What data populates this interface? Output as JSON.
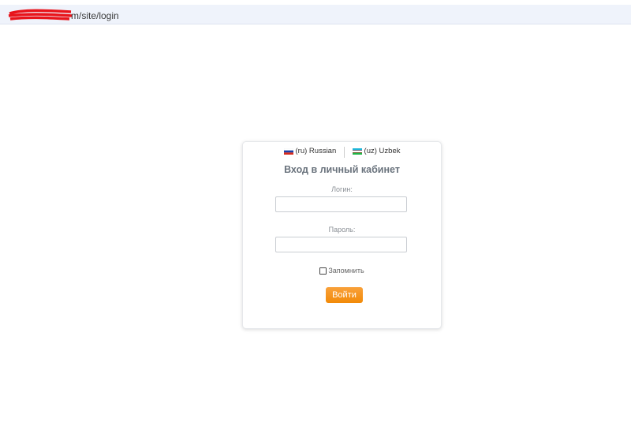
{
  "browser": {
    "url_visible": "m/site/login"
  },
  "languages": [
    {
      "code": "ru",
      "label": "(ru) Russian"
    },
    {
      "code": "uz",
      "label": "(uz) Uzbek"
    }
  ],
  "login_card": {
    "title": "Вход в личный кабинет",
    "login_label": "Логин:",
    "login_value": "",
    "password_label": "Пароль:",
    "password_value": "",
    "remember_label": "Запомнить",
    "remember_checked": false,
    "submit_label": "Войти"
  },
  "colors": {
    "button": "#f28a08",
    "title": "#6a737d",
    "address_bar": "#eff3fb"
  }
}
